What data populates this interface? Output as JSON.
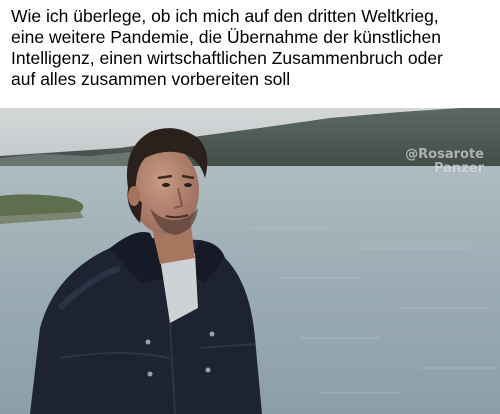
{
  "caption": {
    "lines": [
      "Wie ich überlege, ob ich mich auf den dritten Weltkrieg,",
      "eine weitere Pandemie, die Übernahme der künstlichen",
      "Intelligenz, einen wirtschaftlichen Zusammenbruch oder",
      "auf alles zusammen vorbereiten soll"
    ]
  },
  "watermark": {
    "handle": "@Rosarote",
    "name": "Panzer"
  },
  "colors": {
    "sky": "#c9cdd0",
    "water": "#9fb0b8",
    "hills": "#4e5a55",
    "jacket": "#1d2331"
  }
}
